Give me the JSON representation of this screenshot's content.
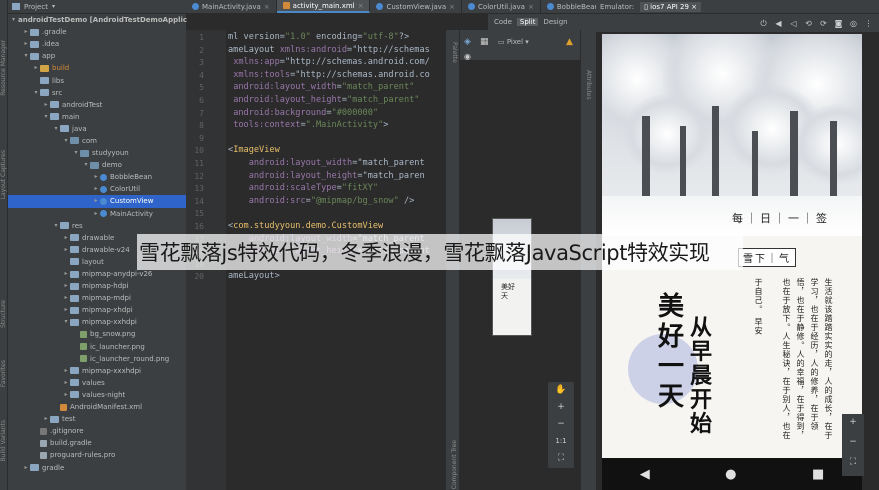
{
  "left_strip": {
    "tabs": [
      "Resource Manager",
      "Layout Captures",
      "Structure",
      "Favorites",
      "Build Variants"
    ]
  },
  "project_panel": {
    "header": "Project",
    "tree": [
      {
        "label": "androidTestDemo [AndroidTestDemoApplic",
        "depth": 0,
        "icon": "folder",
        "open": true,
        "bold": true
      },
      {
        "label": ".gradle",
        "depth": 1,
        "icon": "folder",
        "open": false
      },
      {
        "label": ".idea",
        "depth": 1,
        "icon": "folder",
        "open": false
      },
      {
        "label": "app",
        "depth": 1,
        "icon": "folder",
        "open": true
      },
      {
        "label": "build",
        "depth": 2,
        "icon": "folder-y",
        "open": false,
        "orange": true
      },
      {
        "label": "libs",
        "depth": 2,
        "icon": "folder",
        "open": null
      },
      {
        "label": "src",
        "depth": 2,
        "icon": "folder",
        "open": true
      },
      {
        "label": "androidTest",
        "depth": 3,
        "icon": "folder",
        "open": false
      },
      {
        "label": "main",
        "depth": 3,
        "icon": "folder",
        "open": true
      },
      {
        "label": "java",
        "depth": 4,
        "icon": "folder",
        "open": true
      },
      {
        "label": "com",
        "depth": 5,
        "icon": "pkg",
        "open": true
      },
      {
        "label": "studyyoun",
        "depth": 6,
        "icon": "pkg",
        "open": true
      },
      {
        "label": "demo",
        "depth": 7,
        "icon": "pkg",
        "open": true
      },
      {
        "label": "BobbleBean",
        "depth": 8,
        "icon": "cls",
        "open": false
      },
      {
        "label": "ColorUtil",
        "depth": 8,
        "icon": "cls",
        "open": false
      },
      {
        "label": "CustomView",
        "depth": 8,
        "icon": "cls",
        "open": false,
        "selected": true
      },
      {
        "label": "MainActivity",
        "depth": 8,
        "icon": "cls",
        "open": false
      },
      {
        "label": "res",
        "depth": 4,
        "icon": "folder",
        "open": true
      },
      {
        "label": "drawable",
        "depth": 5,
        "icon": "folder",
        "open": false
      },
      {
        "label": "drawable-v24",
        "depth": 5,
        "icon": "folder",
        "open": false
      },
      {
        "label": "layout",
        "depth": 5,
        "icon": "folder",
        "open": null
      },
      {
        "label": "mipmap-anydpi-v26",
        "depth": 5,
        "icon": "folder",
        "open": false
      },
      {
        "label": "mipmap-hdpi",
        "depth": 5,
        "icon": "folder",
        "open": false
      },
      {
        "label": "mipmap-mdpi",
        "depth": 5,
        "icon": "folder",
        "open": false
      },
      {
        "label": "mipmap-xhdpi",
        "depth": 5,
        "icon": "folder",
        "open": false
      },
      {
        "label": "mipmap-xxhdpi",
        "depth": 5,
        "icon": "folder",
        "open": true
      },
      {
        "label": "bg_snow.png",
        "depth": 6,
        "icon": "img",
        "open": null
      },
      {
        "label": "ic_launcher.png",
        "depth": 6,
        "icon": "img",
        "open": null
      },
      {
        "label": "ic_launcher_round.png",
        "depth": 6,
        "icon": "img",
        "open": null
      },
      {
        "label": "mipmap-xxxhdpi",
        "depth": 5,
        "icon": "folder",
        "open": false
      },
      {
        "label": "values",
        "depth": 5,
        "icon": "folder",
        "open": false
      },
      {
        "label": "values-night",
        "depth": 5,
        "icon": "folder",
        "open": false
      },
      {
        "label": "AndroidManifest.xml",
        "depth": 4,
        "icon": "xml",
        "open": null
      },
      {
        "label": "test",
        "depth": 3,
        "icon": "folder",
        "open": false
      },
      {
        "label": ".gitignore",
        "depth": 2,
        "icon": "git",
        "open": null
      },
      {
        "label": "build.gradle",
        "depth": 2,
        "icon": "file",
        "open": null
      },
      {
        "label": "proguard-rules.pro",
        "depth": 2,
        "icon": "file",
        "open": null
      },
      {
        "label": "gradle",
        "depth": 1,
        "icon": "folder",
        "open": false
      }
    ]
  },
  "editor": {
    "tabs": [
      {
        "label": "MainActivity.java",
        "kind": "java",
        "active": false
      },
      {
        "label": "activity_main.xml",
        "kind": "xml",
        "active": true
      },
      {
        "label": "CustomView.java",
        "kind": "java",
        "active": false
      },
      {
        "label": "ColorUtil.java",
        "kind": "java",
        "active": false
      },
      {
        "label": "BobbleBean.java",
        "kind": "java",
        "active": false
      }
    ],
    "line_numbers": [
      "1",
      "2",
      "3",
      "4",
      "5",
      "6",
      "7",
      "8",
      "9",
      "10",
      "11",
      "12",
      "13",
      "14",
      "15",
      "16",
      "17",
      "18",
      "19",
      "20"
    ],
    "code_lines": [
      "ml version=\"1.0\" encoding=\"utf-8\"?>",
      "ameLayout xmlns:android=\"http://schemas",
      " xmlns:app=\"http://schemas.android.com/",
      " xmlns:tools=\"http://schemas.android.co",
      " android:layout_width=\"match_parent\"",
      " android:layout_height=\"match_parent\"",
      " android:background=\"#000000\"",
      " tools:context=\".MainActivity\">",
      "",
      "<ImageView",
      "    android:layout_width=\"match_parent",
      "    android:layout_height=\"match_paren",
      "    android:scaleType=\"fitXY\"",
      "    android:src=\"@mipmap/bg_snow\" />",
      "",
      "<com.studyyoun.demo.CustomView",
      "    android:layout_width=\"match_parent",
      "    android:layout_height=\"match_parent",
      "",
      "ameLayout>"
    ]
  },
  "design_toolbar": {
    "code": "Code",
    "split": "Split",
    "design": "Design",
    "device": "Pixel",
    "palette": "Palette",
    "attributes": "Attributes",
    "component_tree": "Component Tree"
  },
  "emulator": {
    "label": "Emulator:",
    "device": "ios7 API 29"
  },
  "phone": {
    "calendar": "每｜日｜一｜签",
    "tag": "雪下｜气",
    "big_1": "美",
    "big_2": "好",
    "big_3": "一",
    "big_4": "天",
    "big_5": "从",
    "big_6": "早",
    "big_7": "晨",
    "big_8": "开",
    "big_9": "始",
    "quote_cols": [
      "生活就该踏踏实实的走，人的成长，在于",
      "学习，也在于经历，人的修养，在于领",
      "悟，也在于静修。人的幸福，在于得到，",
      "也在于放下。人生秘诀，在于别人，也在",
      "于自己。  早安"
    ]
  },
  "zoom_controls": {
    "hand": "✋",
    "plus": "+",
    "minus": "−",
    "ratio": "1:1",
    "fit": "⛶"
  },
  "overlay_title": "雪花飘落js特效代码，冬季浪漫，雪花飘落JavaScript特效实现"
}
